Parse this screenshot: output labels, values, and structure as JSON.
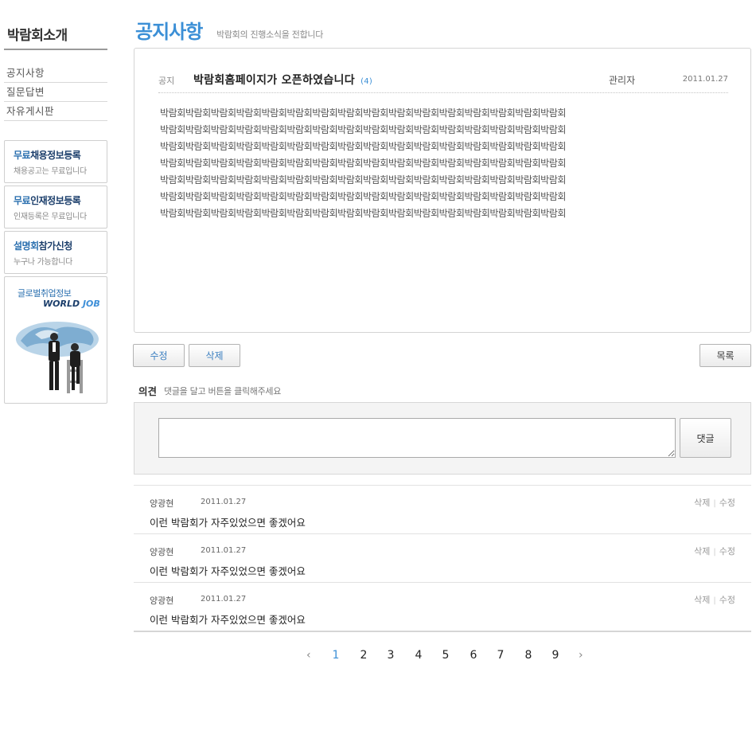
{
  "sidebar": {
    "title": "박람회소개",
    "menu": [
      "공지사항",
      "질문답변",
      "자유게시판"
    ],
    "promos": [
      {
        "title_a": "무료",
        "title_b": "채용정보등록",
        "sub": "채용공고는 무료입니다"
      },
      {
        "title_a": "무료",
        "title_b": "인재정보등록",
        "sub": "인재등록은 무료입니다"
      },
      {
        "title_a": "설명회",
        "title_b": "참가신청",
        "sub": "누구나 가능합니다"
      }
    ],
    "banner": {
      "text": "글로벌취업정보",
      "logo_a": "WORLD ",
      "logo_b": "JOB"
    }
  },
  "header": {
    "title": "공지사항",
    "desc": "박람회의 진행소식을 전합니다"
  },
  "post": {
    "category": "공지",
    "subject": "박람회홈페이지가 오픈하였습니다",
    "comment_count": "(4)",
    "author": "관리자",
    "date": "2011.01.27",
    "body_lines": [
      "박람회박람회박람회박람회박람회박람회박람회박람회박람회박람회박람회박람회박람회박람회박람회박람회",
      "박람회박람회박람회박람회박람회박람회박람회박람회박람회박람회박람회박람회박람회박람회박람회박람회",
      "박람회박람회박람회박람회박람회박람회박람회박람회박람회박람회박람회박람회박람회박람회박람회박람회",
      "박람회박람회박람회박람회박람회박람회박람회박람회박람회박람회박람회박람회박람회박람회박람회박람회",
      "박람회박람회박람회박람회박람회박람회박람회박람회박람회박람회박람회박람회박람회박람회박람회박람회",
      "박람회박람회박람회박람회박람회박람회박람회박람회박람회박람회박람회박람회박람회박람회박람회박람회",
      "박람회박람회박람회박람회박람회박람회박람회박람회박람회박람회박람회박람회박람회박람회박람회박람회"
    ]
  },
  "buttons": {
    "edit": "수정",
    "delete": "삭제",
    "list": "목록",
    "submit": "댓글"
  },
  "opinion": {
    "title": "의견",
    "hint": "댓글을 달고 버튼을 클릭해주세요",
    "input_value": ""
  },
  "comments": [
    {
      "name": "양광현",
      "date": "2011.01.27",
      "delete": "삭제",
      "edit": "수정",
      "text": "이런 박람회가 자주있었으면 좋겠어요"
    },
    {
      "name": "양광현",
      "date": "2011.01.27",
      "delete": "삭제",
      "edit": "수정",
      "text": "이런 박람회가 자주있었으면 좋겠어요"
    },
    {
      "name": "양광현",
      "date": "2011.01.27",
      "delete": "삭제",
      "edit": "수정",
      "text": "이런 박람회가 자주있었으면 좋겠어요"
    }
  ],
  "pagination": {
    "prev": "‹",
    "next": "›",
    "pages": [
      "1",
      "2",
      "3",
      "4",
      "5",
      "6",
      "7",
      "8",
      "9"
    ],
    "current": "1"
  },
  "colors": {
    "accent": "#3b8fd6",
    "brand_dark": "#1b3e6b"
  }
}
